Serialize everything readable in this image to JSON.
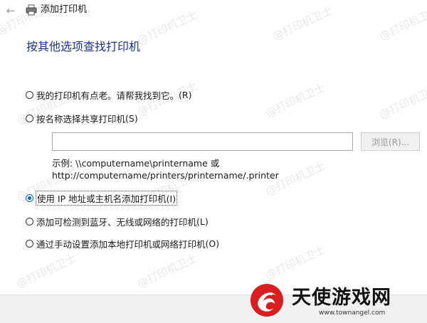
{
  "window": {
    "title": "添加打印机"
  },
  "heading": "按其他选项查找打印机",
  "options": [
    {
      "label": "我的打印机有点老。请帮我找到它。",
      "key": "(R)",
      "checked": false
    },
    {
      "label": "按名称选择共享打印机",
      "key": "(S)",
      "checked": false
    },
    {
      "label": "使用 IP 地址或主机名添加打印机",
      "key": "(I)",
      "checked": true
    },
    {
      "label": "添加可检测到蓝牙、无线或网络的打印机",
      "key": "(L)",
      "checked": false
    },
    {
      "label": "通过手动设置添加本地打印机或网络打印机",
      "key": "(O)",
      "checked": false
    }
  ],
  "share": {
    "input_value": "",
    "browse_label": "浏览(R)...",
    "example_line1": "示例: \\\\computername\\printername 或",
    "example_line2": "http://computername/printers/printername/.printer"
  },
  "watermark": "@打印机卫士",
  "logo": {
    "text": "天使游戏网",
    "url": "www.townangel.com"
  },
  "colors": {
    "heading": "#1e3287",
    "radio_accent": "#0067c0"
  }
}
